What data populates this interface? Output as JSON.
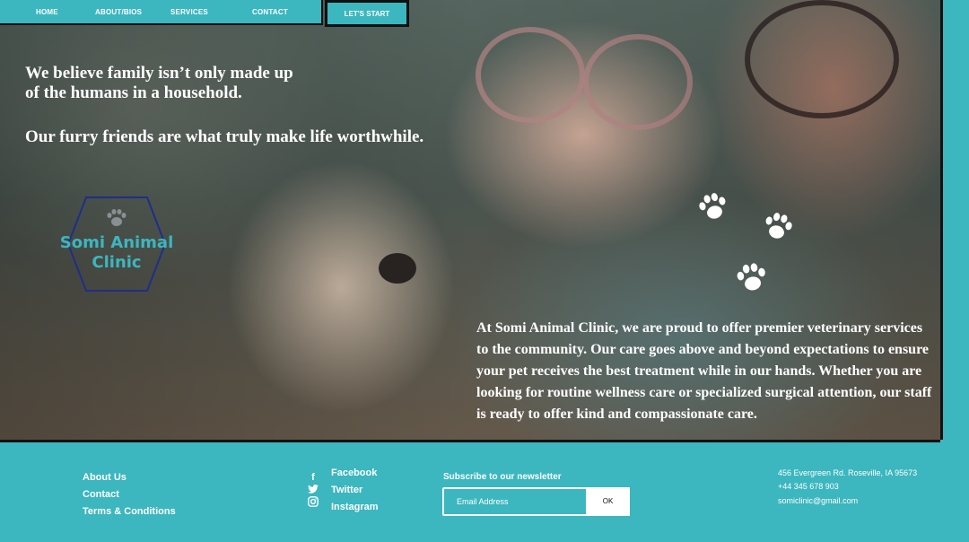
{
  "nav": {
    "items": [
      "HOME",
      "ABOUT/BIOS",
      "SERVICES",
      "CONTACT"
    ],
    "cta": "LET'S START"
  },
  "hero": {
    "headline_line1": "We believe family isn’t only made up",
    "headline_line2": "of the humans in a household.",
    "headline_line3": "Our furry friends are what truly make life worthwhile.",
    "body": "At Somi Animal Clinic, we are proud to offer premier veterinary services to the community. Our care goes above and beyond expectations to ensure your pet receives the best treatment while in our hands. Whether you are looking for routine wellness care or specialized surgical attention, our staff is ready to offer kind and compassionate care."
  },
  "logo": {
    "line1": "Somi Animal",
    "line2": "Clinic",
    "icon": "paw-icon"
  },
  "footer": {
    "links": [
      "About Us",
      "Contact",
      "Terms & Conditions"
    ],
    "social": [
      {
        "label": "Facebook",
        "icon": "facebook-icon"
      },
      {
        "label": "Twitter",
        "icon": "twitter-icon"
      },
      {
        "label": "Instagram",
        "icon": "instagram-icon"
      }
    ],
    "newsletter": {
      "label": "Subscribe to our newsletter",
      "placeholder": "Email Address",
      "button": "OK"
    },
    "contact": {
      "address": "456 Evergreen Rd. Roseville, IA 95673",
      "phone": "+44 345 678 903",
      "email": "somiclinic@gmail.com"
    }
  },
  "colors": {
    "accent": "#3cb6bf",
    "logo_border": "#1f2e8a",
    "text": "#ffffff"
  }
}
